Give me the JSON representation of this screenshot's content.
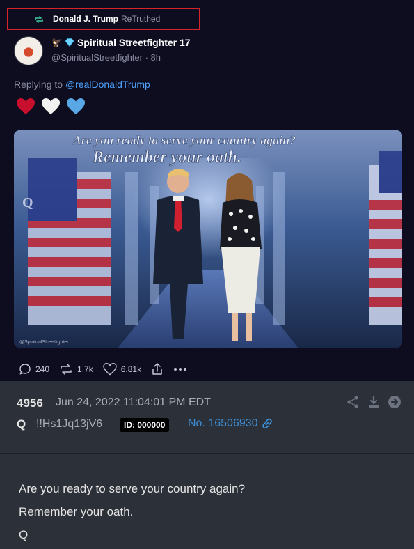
{
  "retruth": {
    "name": "Donald J. Trump",
    "suffix": "ReTruthed"
  },
  "author": {
    "display_name": "Spiritual Streetfighter 17",
    "handle": "@SpiritualStreetfighter",
    "time": "· 8h"
  },
  "reply": {
    "prefix": "Replying to",
    "mention": "@realDonaldTrump"
  },
  "hearts": [
    "#c8102e",
    "#f2f2f2",
    "#5aa7e6"
  ],
  "image": {
    "caption_line1": "Are you ready to serve your country again?",
    "caption_line2": "Remember your oath.",
    "watermark_q": "Q",
    "credit": "@SpiritualStreetfighter"
  },
  "actions": {
    "replies": "240",
    "retruths": "1.7k",
    "likes": "6.81k"
  },
  "qpost": {
    "number": "4956",
    "date": "Jun 24, 2022 11:04:01 PM EDT",
    "name": "Q",
    "tripcode": "!!Hs1Jq13jV6",
    "id_badge": "ID: 000000",
    "post_no": "No. 16506930",
    "body_line1": "Are you ready to serve your country again?",
    "body_line2": "Remember your oath.",
    "body_line3": "Q"
  },
  "colors": {
    "background": "#0d0d1f",
    "q_background": "#2c3038",
    "link": "#4da3ff",
    "highlight_border": "#d8232a",
    "retruth_icon": "#3cc9a0"
  }
}
